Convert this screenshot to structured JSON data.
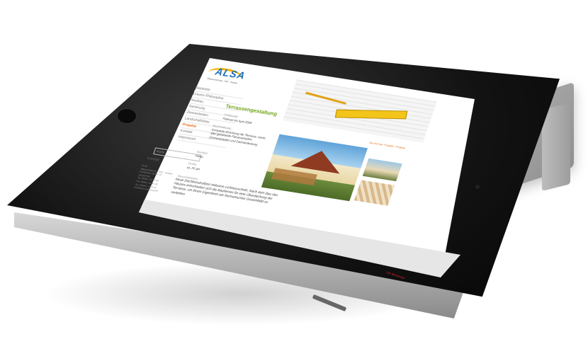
{
  "page": {
    "logo": "ALSA",
    "logo_tagline": "Altbausanierung · Holz · Ausbau",
    "nav": [
      "Startseite",
      "Unsere Philosophie",
      "Neubau",
      "Sanierung",
      "Zimmerbeiten",
      "Landschaftsbau",
      "Projekte",
      "Kontakt",
      "Impressum"
    ],
    "active_nav_index": 6,
    "search_placeholder": "Suche",
    "contact_title": "Kontakt",
    "address_lines": [
      "ALSA",
      "Altbausanierung · Holz · Ausbau",
      "Frankfurter-Straße 18",
      "63128 Pohl",
      "Tel. 06061 / 82 60 44",
      "Fax 06061 / 82 60 45",
      "Tel. 0049/17 / 820 20",
      "info@alsa-sanierung.de"
    ],
    "project_title": "Terrassengestaltung",
    "breadcrumb": "Sie sind hier: Projekte > Projekte",
    "meta": {
      "period_label": "Umbauzeit:",
      "period_value": "Februar bis April 2009",
      "description_label": "Beschreibung:",
      "description_value": "Komplette Errichtung der Terrasse, sowie aller gehörende Fliesenarbeiten, Zimmerarbeiten und Dachabdeckung",
      "location_label": "Standort:",
      "location_value": "Pohl",
      "size_label": "Größe:",
      "size_value": "ca. 25 qm",
      "special_label": "Besonderheiten:",
      "special_value": "Neue Dachkonstruktion inklusive Lichtausschnitt. Nach dem Bau des Hauses entschieden sich die Bauherren für eine Überdachung der Terrasse, um ihrem Eigenheim ein harmonisches Gesamtbild zu verleihen."
    },
    "footer_brand": "GfA Webdesign"
  },
  "colors": {
    "accent_orange": "#e36a1a",
    "title_green": "#73a51d",
    "logo_blue": "#1c6fb8",
    "bezel": "#111111"
  }
}
